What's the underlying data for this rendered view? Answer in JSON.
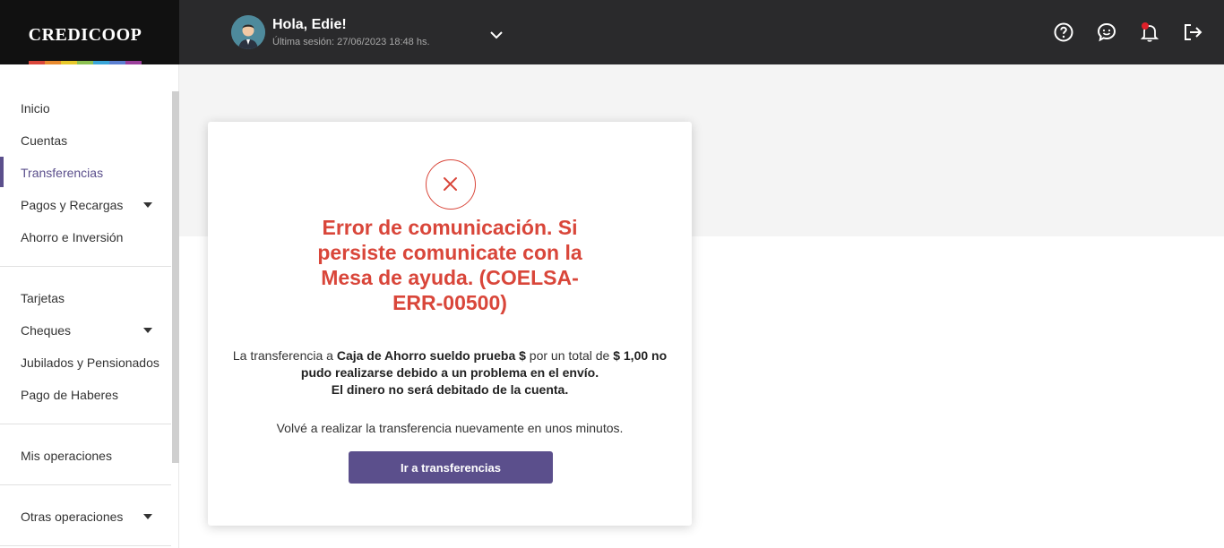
{
  "brand": {
    "logo_text": "CREDICOOP",
    "accent_color": "#5b4f8c",
    "error_color": "#d9463a",
    "rainbow_colors": [
      "#d9463a",
      "#e88a2e",
      "#e7c82a",
      "#8cc152",
      "#3aa6d9",
      "#5b7fd1",
      "#9b3f9b"
    ]
  },
  "header": {
    "greeting": "Hola, Edie!",
    "last_session": "Última sesión: 27/06/2023 18:48 hs.",
    "icons": [
      "help-icon",
      "chat-icon",
      "bell-icon",
      "logout-icon"
    ]
  },
  "sidebar": {
    "groups": [
      {
        "items": [
          {
            "label": "Inicio"
          },
          {
            "label": "Cuentas"
          },
          {
            "label": "Transferencias",
            "active": true
          },
          {
            "label": "Pagos y Recargas",
            "expandable": true
          },
          {
            "label": "Ahorro e Inversión"
          }
        ]
      },
      {
        "items": [
          {
            "label": "Tarjetas"
          },
          {
            "label": "Cheques",
            "expandable": true
          },
          {
            "label": "Jubilados y Pensionados"
          },
          {
            "label": "Pago de Haberes"
          }
        ]
      },
      {
        "items": [
          {
            "label": "Mis operaciones"
          }
        ]
      },
      {
        "items": [
          {
            "label": "Otras operaciones",
            "expandable": true
          }
        ]
      }
    ]
  },
  "modal": {
    "title": "Error de comunicación. Si persiste comunicate con la Mesa de ayuda. (COELSA-ERR-00500)",
    "message_pre": "La transferencia a ",
    "account_name": "Caja de Ahorro sueldo prueba $",
    "message_mid": " por un total de ",
    "amount": "$ 1,00 no pudo realizarse debido a un problema en el envío.",
    "not_debited": "El dinero no será debitado de la cuenta.",
    "retry_text": "Volvé a realizar la transferencia nuevamente en unos minutos.",
    "button_label": "Ir a transferencias"
  }
}
